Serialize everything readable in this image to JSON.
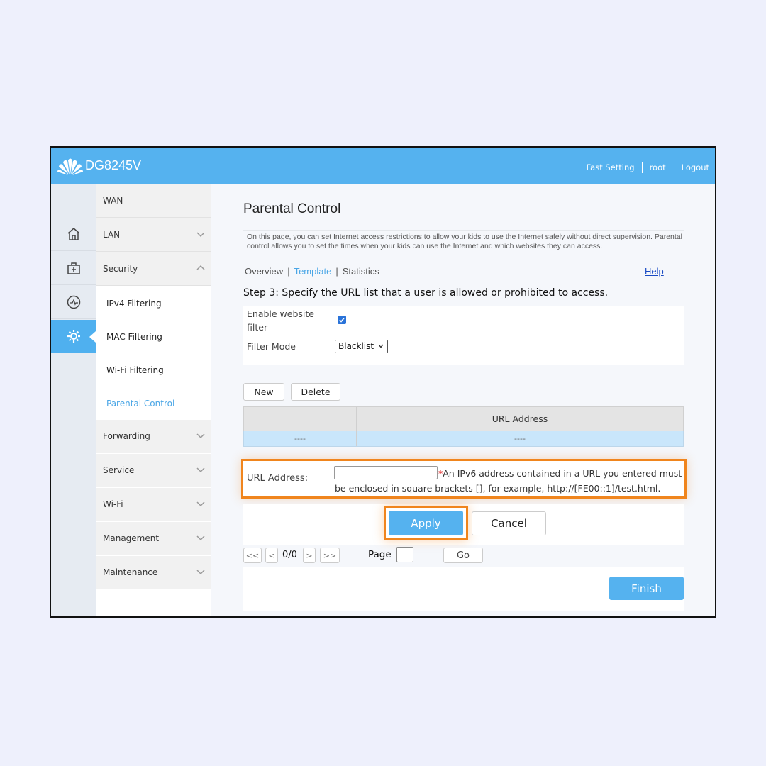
{
  "header": {
    "brand": "DG8245V",
    "links": [
      "Fast Setting",
      "root",
      "Logout"
    ]
  },
  "icon_rail": [
    "home-icon",
    "medkit-icon",
    "monitor-icon",
    "gear-icon"
  ],
  "menu": {
    "items": [
      {
        "label": "WAN",
        "expandable": false
      },
      {
        "label": "LAN",
        "expandable": true,
        "expanded": false
      },
      {
        "label": "Security",
        "expandable": true,
        "expanded": true
      }
    ],
    "security_sub": [
      "IPv4 Filtering",
      "MAC Filtering",
      "Wi-Fi Filtering",
      "Parental Control"
    ],
    "active_sub": "Parental Control",
    "lower_items": [
      "Forwarding",
      "Service",
      "Wi-Fi",
      "Management",
      "Maintenance"
    ]
  },
  "page": {
    "title": "Parental Control",
    "description": "On this page, you can set Internet access restrictions to allow your kids to use the Internet safely without direct supervision. Parental control allows you to set the times when your kids can use the Internet and which websites they can access.",
    "tabs": [
      "Overview",
      "Template",
      "Statistics"
    ],
    "active_tab": "Template",
    "help": "Help",
    "step": "Step 3: Specify the URL list that a user is allowed or prohibited to access.",
    "enable_label": "Enable website filter",
    "enable_checked": true,
    "filter_mode_label": "Filter Mode",
    "filter_mode_value": "Blacklist",
    "new_btn": "New",
    "delete_btn": "Delete",
    "table": {
      "headers": [
        "",
        "URL Address"
      ],
      "rows": [
        [
          "----",
          "----"
        ]
      ]
    },
    "url_label": "URL Address:",
    "url_value": "",
    "url_note_star": "*",
    "url_note": "An IPv6 address contained in a URL you entered must be enclosed in square brackets [], for example, http://[FE00::1]/test.html.",
    "apply_btn": "Apply",
    "cancel_btn": "Cancel",
    "pager": {
      "first": "<<",
      "prev": "<",
      "status": "0/0",
      "next": ">",
      "last": ">>",
      "page_label": "Page",
      "page_value": "",
      "go": "Go"
    },
    "finish_btn": "Finish"
  },
  "colors": {
    "accent": "#55b2ef",
    "highlight": "#f0851d",
    "active_text": "#4aa6e6"
  }
}
